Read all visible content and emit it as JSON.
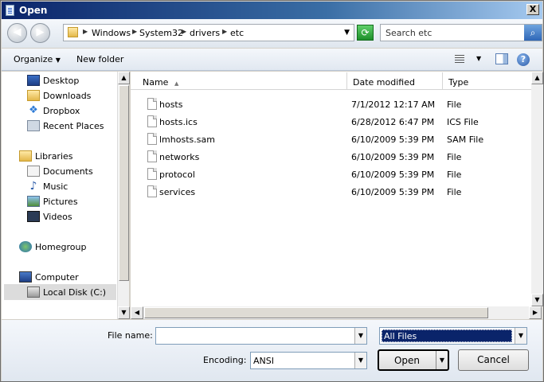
{
  "window": {
    "title": "Open",
    "close_label": "X"
  },
  "address": {
    "crumbs": [
      "Windows",
      "System32",
      "drivers",
      "etc"
    ]
  },
  "search": {
    "placeholder": "Search etc"
  },
  "toolbar": {
    "organize": "Organize",
    "new_folder": "New folder"
  },
  "nav": {
    "favorites": [
      "Desktop",
      "Downloads",
      "Dropbox",
      "Recent Places"
    ],
    "libraries_label": "Libraries",
    "libraries": [
      "Documents",
      "Music",
      "Pictures",
      "Videos"
    ],
    "homegroup": "Homegroup",
    "computer": "Computer",
    "local_disk": "Local Disk (C:)",
    "selected": "Local Disk (C:)"
  },
  "columns": {
    "name": "Name",
    "date": "Date modified",
    "type": "Type"
  },
  "files": [
    {
      "name": "hosts",
      "date": "7/1/2012 12:17 AM",
      "type": "File"
    },
    {
      "name": "hosts.ics",
      "date": "6/28/2012 6:47 PM",
      "type": "ICS File"
    },
    {
      "name": "lmhosts.sam",
      "date": "6/10/2009 5:39 PM",
      "type": "SAM File"
    },
    {
      "name": "networks",
      "date": "6/10/2009 5:39 PM",
      "type": "File"
    },
    {
      "name": "protocol",
      "date": "6/10/2009 5:39 PM",
      "type": "File"
    },
    {
      "name": "services",
      "date": "6/10/2009 5:39 PM",
      "type": "File"
    }
  ],
  "bottom": {
    "filename_label": "File name:",
    "filename_value": "",
    "filter_value": "All Files",
    "encoding_label": "Encoding:",
    "encoding_value": "ANSI",
    "open_label": "Open",
    "cancel_label": "Cancel"
  },
  "colors": {
    "title_bar": "#0a246a",
    "selection": "#0a246a"
  }
}
